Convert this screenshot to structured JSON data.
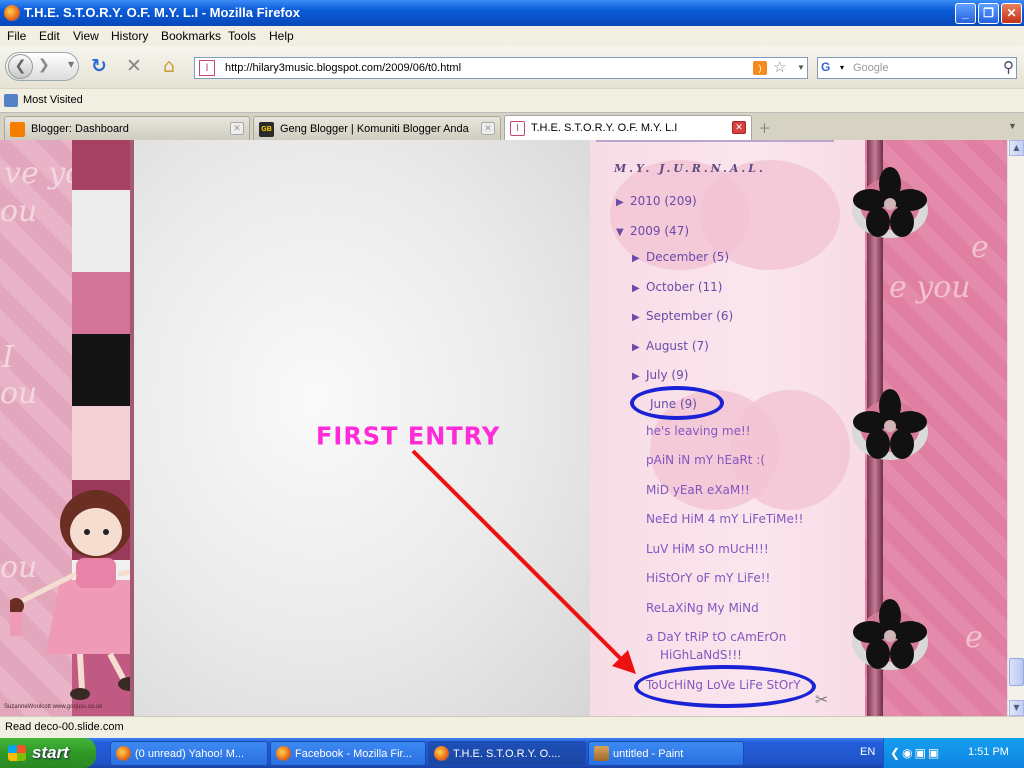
{
  "window": {
    "title": "T.H.E. S.T.O.R.Y. O.F. M.Y. L.I - Mozilla Firefox"
  },
  "menu": [
    "File",
    "Edit",
    "View",
    "History",
    "Bookmarks",
    "Tools",
    "Help"
  ],
  "nav": {
    "url": "http://hilary3music.blogspot.com/2009/06/t0.html",
    "search_placeholder": "Google"
  },
  "bookmarks": {
    "most_visited": "Most Visited"
  },
  "tabs": [
    {
      "label": "Blogger: Dashboard",
      "icon": "blogger-icon",
      "color": "#f57d00"
    },
    {
      "label": "Geng Blogger | Komuniti Blogger Anda",
      "icon": "gb-icon",
      "color": "#2a2a2a"
    },
    {
      "label": "T.H.E. S.T.O.R.Y. O.F. M.Y. L.I",
      "icon": "blog-favicon",
      "color": "#c7447a",
      "active": true
    }
  ],
  "blog": {
    "archive_title": "M.Y. J.U.R.N.A.L.",
    "years": [
      {
        "label": "2010",
        "count": "(209)",
        "expanded": false
      },
      {
        "label": "2009",
        "count": "(47)",
        "expanded": true
      }
    ],
    "months": [
      {
        "label": "December",
        "count": "(5)"
      },
      {
        "label": "October",
        "count": "(11)"
      },
      {
        "label": "September",
        "count": "(6)"
      },
      {
        "label": "August",
        "count": "(7)"
      },
      {
        "label": "July",
        "count": "(9)"
      },
      {
        "label": "June",
        "count": "(9)",
        "expanded": true
      }
    ],
    "posts": [
      "he's leaving me!!",
      "pAiN iN mY hEaRt :(",
      "MiD yEaR eXaM!!",
      "NeEd HiM 4 mY LiFeTiMe!!",
      "LuV HiM sO mUcH!!!",
      "HiStOrY oF mY LiFe!!",
      "ReLaXiNg My MiNd",
      "a DaY tRiP tO cAmErOn",
      "HiGhLaNdS!!!",
      "ToUcHiNg LoVe LiFe StOrY"
    ],
    "annotation": "FIRST ENTRY",
    "image_credit": "SuzanneWoolcott www.gorjuss.co.uk",
    "annotation_color": "#ff2ad8",
    "arrow_color": "#ee1111",
    "circle_color": "#1a22d6"
  },
  "status": "Read deco-00.slide.com",
  "taskbar": {
    "start": "start",
    "tasks": [
      "(0 unread) Yahoo! M...",
      "Facebook - Mozilla Fir...",
      "T.H.E. S.T.O.R.Y. O....",
      "untitled - Paint"
    ],
    "lang": "EN",
    "clock": "1:51 PM"
  }
}
